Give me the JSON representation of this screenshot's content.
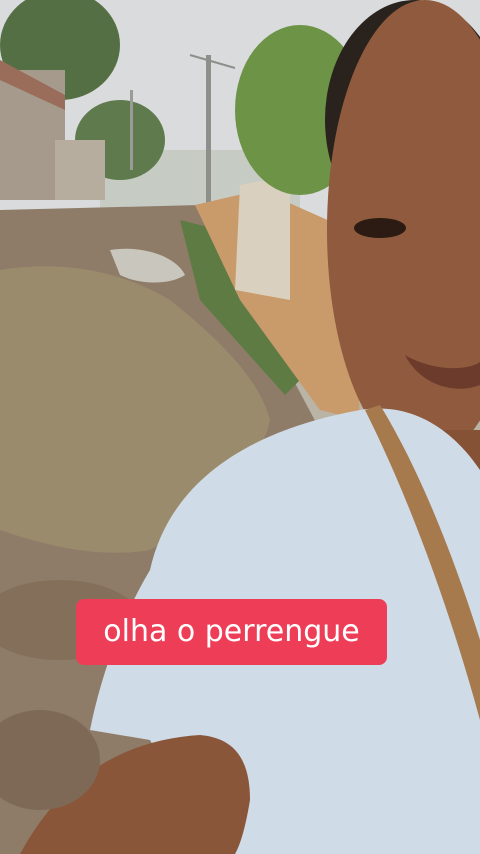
{
  "overlay": {
    "caption_text": "olha o perrengue",
    "caption_bg_color": "#ee3e57",
    "caption_text_color": "#ffffff"
  },
  "scene": {
    "description_elements": [
      "sky",
      "trees",
      "houses",
      "utility-pole",
      "muddy-road",
      "puddle",
      "orange-wall",
      "person",
      "shirt",
      "bag-strap"
    ]
  }
}
